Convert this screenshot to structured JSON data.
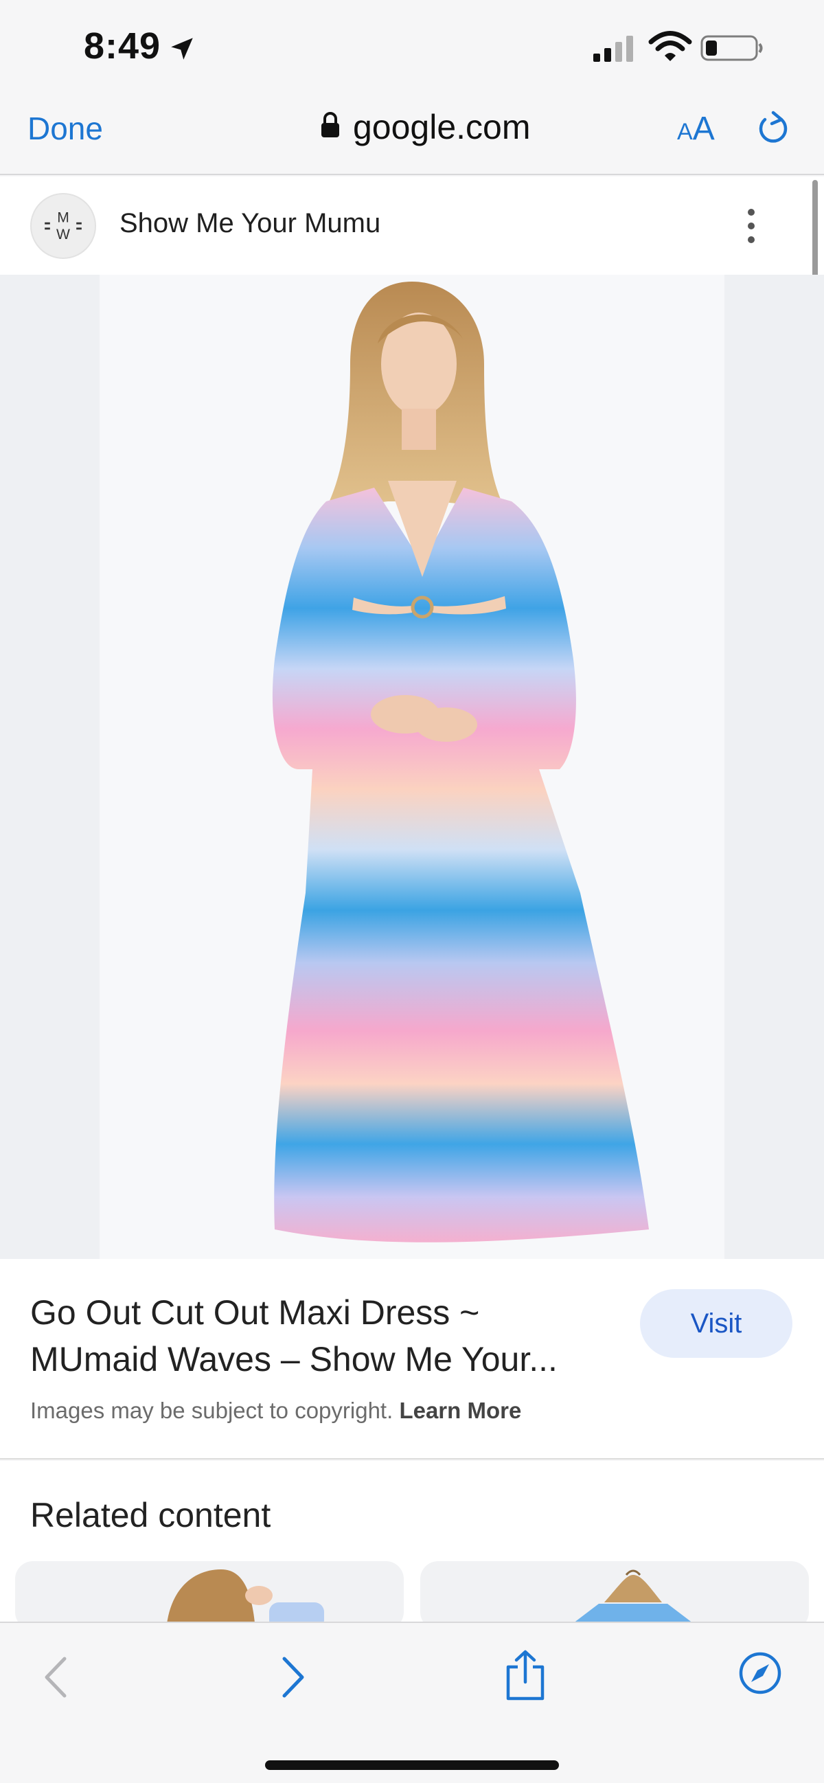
{
  "status_bar": {
    "time": "8:49",
    "icons": [
      "location-arrow-icon",
      "cellular-signal-icon",
      "wifi-icon",
      "battery-icon"
    ]
  },
  "browser": {
    "done_label": "Done",
    "domain": "google.com",
    "aa_label_small": "A",
    "aa_label_big": "A",
    "accent_color": "#1d76d2"
  },
  "source": {
    "logo_text": "M W",
    "name": "Show Me Your Mumu"
  },
  "result": {
    "title_line1": "Go Out Cut Out Maxi Dress ~",
    "title_line2": "MUmaid Waves – Show Me Your...",
    "visit_label": "Visit",
    "copyright_text": "Images may be subject to copyright.",
    "learn_more_label": "Learn More"
  },
  "related": {
    "title": "Related content"
  },
  "toolbar": {
    "icons": [
      "back-icon",
      "forward-icon",
      "share-icon",
      "compass-icon"
    ]
  }
}
